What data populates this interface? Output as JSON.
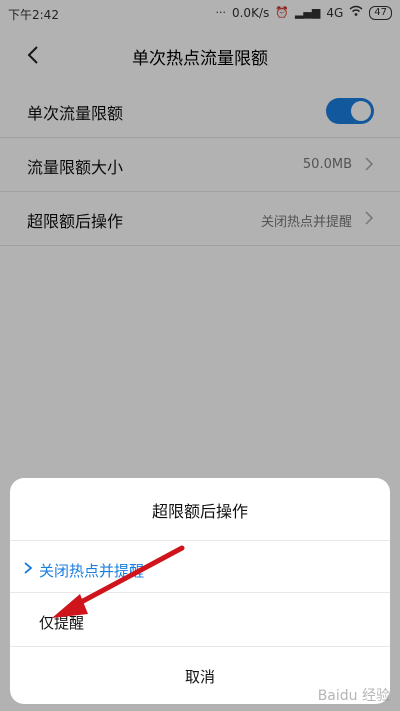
{
  "status_bar": {
    "time": "下午2:42",
    "network_speed": "0.0K/s",
    "network_type": "4G",
    "battery": "47",
    "icons": [
      "alarm-icon",
      "signal-icon",
      "wifi-icon",
      "battery-icon"
    ]
  },
  "header": {
    "title": "单次热点流量限额",
    "back_icon": "back-arrow-icon"
  },
  "settings": {
    "rows": [
      {
        "label": "单次流量限额",
        "type": "toggle",
        "enabled": true
      },
      {
        "label": "流量限额大小",
        "type": "value",
        "value": "50.0MB"
      },
      {
        "label": "超限额后操作",
        "type": "value",
        "value": "关闭热点并提醒"
      }
    ]
  },
  "dialog": {
    "title": "超限额后操作",
    "options": [
      {
        "label": "关闭热点并提醒",
        "selected": true
      },
      {
        "label": "仅提醒",
        "selected": false
      }
    ],
    "cancel_label": "取消"
  },
  "annotation": {
    "arrow_color": "#d0141b",
    "target": "仅提醒"
  },
  "watermark": "Baidu 经验",
  "colors": {
    "accent": "#1a7ee0",
    "background": "#ffffff",
    "overlay": "rgba(0,0,0,0.30)"
  }
}
